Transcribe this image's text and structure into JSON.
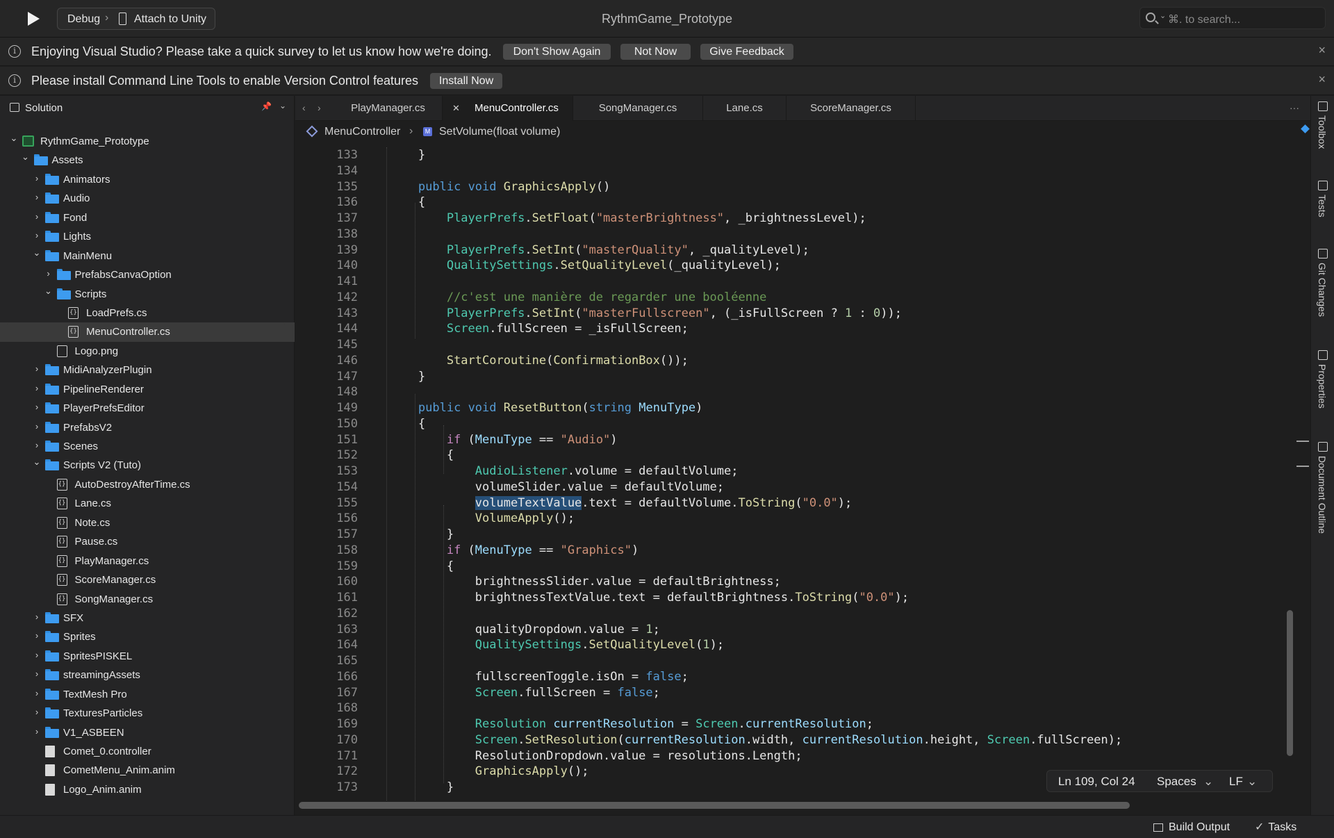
{
  "titlebar": {
    "run_config": "Debug",
    "run_sep": "›",
    "target": "Attach to Unity",
    "title": "RythmGame_Prototype",
    "search_placeholder": "⌘. to search..."
  },
  "survey_bar": {
    "message": "Enjoying Visual Studio? Please take a quick survey to let us know how we're doing.",
    "buttons": [
      "Don't Show Again",
      "Not Now",
      "Give Feedback"
    ]
  },
  "vc_bar": {
    "message": "Please install Command Line Tools to enable Version Control features",
    "button": "Install Now"
  },
  "sidebar": {
    "title": "Solution",
    "items": [
      {
        "label": "RythmGame_Prototype",
        "depth": 0,
        "type": "project",
        "expanded": true
      },
      {
        "label": "Assets",
        "depth": 1,
        "type": "folder",
        "expanded": true
      },
      {
        "label": "Animators",
        "depth": 2,
        "type": "folder",
        "expanded": false
      },
      {
        "label": "Audio",
        "depth": 2,
        "type": "folder",
        "expanded": false
      },
      {
        "label": "Fond",
        "depth": 2,
        "type": "folder",
        "expanded": false
      },
      {
        "label": "Lights",
        "depth": 2,
        "type": "folder",
        "expanded": false
      },
      {
        "label": "MainMenu",
        "depth": 2,
        "type": "folder",
        "expanded": true
      },
      {
        "label": "PrefabsCanvaOption",
        "depth": 3,
        "type": "folder",
        "expanded": false
      },
      {
        "label": "Scripts",
        "depth": 3,
        "type": "folder",
        "expanded": true
      },
      {
        "label": "LoadPrefs.cs",
        "depth": 4,
        "type": "cs"
      },
      {
        "label": "MenuController.cs",
        "depth": 4,
        "type": "cs",
        "selected": true
      },
      {
        "label": "Logo.png",
        "depth": 3,
        "type": "image"
      },
      {
        "label": "MidiAnalyzerPlugin",
        "depth": 2,
        "type": "folder",
        "expanded": false
      },
      {
        "label": "PipelineRenderer",
        "depth": 2,
        "type": "folder",
        "expanded": false
      },
      {
        "label": "PlayerPrefsEditor",
        "depth": 2,
        "type": "folder",
        "expanded": false
      },
      {
        "label": "PrefabsV2",
        "depth": 2,
        "type": "folder",
        "expanded": false
      },
      {
        "label": "Scenes",
        "depth": 2,
        "type": "folder",
        "expanded": false
      },
      {
        "label": "Scripts V2 (Tuto)",
        "depth": 2,
        "type": "folder",
        "expanded": true
      },
      {
        "label": "AutoDestroyAfterTime.cs",
        "depth": 3,
        "type": "cs"
      },
      {
        "label": "Lane.cs",
        "depth": 3,
        "type": "cs"
      },
      {
        "label": "Note.cs",
        "depth": 3,
        "type": "cs"
      },
      {
        "label": "Pause.cs",
        "depth": 3,
        "type": "cs"
      },
      {
        "label": "PlayManager.cs",
        "depth": 3,
        "type": "cs"
      },
      {
        "label": "ScoreManager.cs",
        "depth": 3,
        "type": "cs"
      },
      {
        "label": "SongManager.cs",
        "depth": 3,
        "type": "cs"
      },
      {
        "label": "SFX",
        "depth": 2,
        "type": "folder",
        "expanded": false
      },
      {
        "label": "Sprites",
        "depth": 2,
        "type": "folder",
        "expanded": false
      },
      {
        "label": "SpritesPISKEL",
        "depth": 2,
        "type": "folder",
        "expanded": false
      },
      {
        "label": "streamingAssets",
        "depth": 2,
        "type": "folder",
        "expanded": false
      },
      {
        "label": "TextMesh Pro",
        "depth": 2,
        "type": "folder",
        "expanded": false
      },
      {
        "label": "TexturesParticles",
        "depth": 2,
        "type": "folder",
        "expanded": false
      },
      {
        "label": "V1_ASBEEN",
        "depth": 2,
        "type": "folder",
        "expanded": false
      },
      {
        "label": "Comet_0.controller",
        "depth": 2,
        "type": "file"
      },
      {
        "label": "CometMenu_Anim.anim",
        "depth": 2,
        "type": "file"
      },
      {
        "label": "Logo_Anim.anim",
        "depth": 2,
        "type": "file"
      }
    ]
  },
  "tabs": [
    {
      "label": "PlayManager.cs",
      "active": false
    },
    {
      "label": "MenuController.cs",
      "active": true
    },
    {
      "label": "SongManager.cs",
      "active": false
    },
    {
      "label": "Lane.cs",
      "active": false
    },
    {
      "label": "ScoreManager.cs",
      "active": false
    }
  ],
  "breadcrumb": {
    "class": "MenuController",
    "sep": "›",
    "method": "SetVolume(float volume)"
  },
  "code_lines": [
    {
      "n": 133,
      "t": "        }"
    },
    {
      "n": 134,
      "t": ""
    },
    {
      "n": 135,
      "t": "        public void GraphicsApply()"
    },
    {
      "n": 136,
      "t": "        {"
    },
    {
      "n": 137,
      "t": "            PlayerPrefs.SetFloat(\"masterBrightness\", _brightnessLevel);"
    },
    {
      "n": 138,
      "t": ""
    },
    {
      "n": 139,
      "t": "            PlayerPrefs.SetInt(\"masterQuality\", _qualityLevel);"
    },
    {
      "n": 140,
      "t": "            QualitySettings.SetQualityLevel(_qualityLevel);"
    },
    {
      "n": 141,
      "t": ""
    },
    {
      "n": 142,
      "t": "            //c'est une manière de regarder une booléenne"
    },
    {
      "n": 143,
      "t": "            PlayerPrefs.SetInt(\"masterFullscreen\", (_isFullScreen ? 1 : 0));"
    },
    {
      "n": 144,
      "t": "            Screen.fullScreen = _isFullScreen;"
    },
    {
      "n": 145,
      "t": ""
    },
    {
      "n": 146,
      "t": "            StartCoroutine(ConfirmationBox());"
    },
    {
      "n": 147,
      "t": "        }"
    },
    {
      "n": 148,
      "t": ""
    },
    {
      "n": 149,
      "t": "        public void ResetButton(string MenuType)"
    },
    {
      "n": 150,
      "t": "        {"
    },
    {
      "n": 151,
      "t": "            if (MenuType == \"Audio\")"
    },
    {
      "n": 152,
      "t": "            {"
    },
    {
      "n": 153,
      "t": "                AudioListener.volume = defaultVolume;"
    },
    {
      "n": 154,
      "t": "                volumeSlider.value = defaultVolume;"
    },
    {
      "n": 155,
      "t": "                volumeTextValue.text = defaultVolume.ToString(\"0.0\");"
    },
    {
      "n": 156,
      "t": "                VolumeApply();"
    },
    {
      "n": 157,
      "t": "            }"
    },
    {
      "n": 158,
      "t": "            if (MenuType == \"Graphics\")"
    },
    {
      "n": 159,
      "t": "            {"
    },
    {
      "n": 160,
      "t": "                brightnessSlider.value = defaultBrightness;"
    },
    {
      "n": 161,
      "t": "                brightnessTextValue.text = defaultBrightness.ToString(\"0.0\");"
    },
    {
      "n": 162,
      "t": ""
    },
    {
      "n": 163,
      "t": "                qualityDropdown.value = 1;"
    },
    {
      "n": 164,
      "t": "                QualitySettings.SetQualityLevel(1);"
    },
    {
      "n": 165,
      "t": ""
    },
    {
      "n": 166,
      "t": "                fullscreenToggle.isOn = false;"
    },
    {
      "n": 167,
      "t": "                Screen.fullScreen = false;"
    },
    {
      "n": 168,
      "t": ""
    },
    {
      "n": 169,
      "t": "                Resolution currentResolution = Screen.currentResolution;"
    },
    {
      "n": 170,
      "t": "                Screen.SetResolution(currentResolution.width, currentResolution.height, Screen.fullScreen);"
    },
    {
      "n": 171,
      "t": "                ResolutionDropdown.value = resolutions.Length;"
    },
    {
      "n": 172,
      "t": "                GraphicsApply();"
    },
    {
      "n": 173,
      "t": "            }"
    }
  ],
  "status": {
    "position": "Ln 109, Col 24",
    "indent": "Spaces",
    "eol": "LF"
  },
  "right_panel": [
    "Toolbox",
    "Tests",
    "Git Changes",
    "Properties",
    "Document Outline"
  ],
  "bottom": {
    "build_output": "Build Output",
    "tasks": "Tasks"
  },
  "colors": {
    "keyword": "#569cd6",
    "control": "#c586c0",
    "type": "#4ec9b0",
    "method": "#dcdcaa",
    "string": "#ce9178",
    "comment": "#6a9955",
    "number": "#b5cea8",
    "variable": "#9cdcfe",
    "folder": "#3d9bf0",
    "background": "#1e1e1e"
  }
}
